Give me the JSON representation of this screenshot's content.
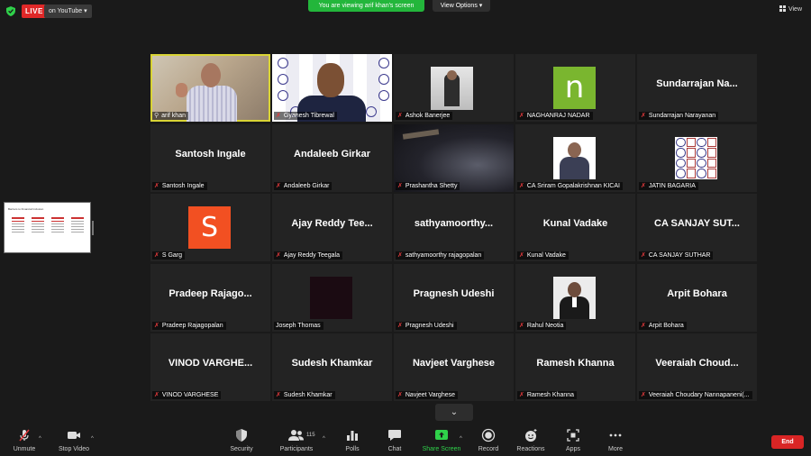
{
  "topbar": {
    "live_label": "LIVE",
    "stream_target": "on YouTube",
    "viewing_banner": "You are viewing arif khan's screen",
    "view_options": "View Options",
    "view_button": "View"
  },
  "shared_screen": {
    "title": "Barriers to Financial Inclusion"
  },
  "participants": [
    {
      "label": "arif khan",
      "tile_name": "",
      "kind": "video-arif",
      "muted": false,
      "pinned": true,
      "active": true
    },
    {
      "label": "Gyanesh Tibrewal",
      "tile_name": "",
      "kind": "video-gyan",
      "muted": true
    },
    {
      "label": "Ashok Banerjee",
      "tile_name": "",
      "kind": "photo-ashok",
      "muted": true
    },
    {
      "label": "NAGHANRAJ NADAR",
      "tile_name": "",
      "kind": "avatar-n",
      "avatar_letter": "n",
      "muted": true
    },
    {
      "label": "Sundarrajan Narayanan",
      "tile_name": "Sundarrajan Na...",
      "kind": "name",
      "muted": true
    },
    {
      "label": "Santosh Ingale",
      "tile_name": "Santosh Ingale",
      "kind": "name",
      "muted": true
    },
    {
      "label": "Andaleeb Girkar",
      "tile_name": "Andaleeb Girkar",
      "kind": "name",
      "muted": true
    },
    {
      "label": "Prashantha Shetty",
      "tile_name": "",
      "kind": "video-prash",
      "muted": true
    },
    {
      "label": "CA Sriram Gopalakrishnan KICAI",
      "tile_name": "",
      "kind": "photo-sriram",
      "muted": true
    },
    {
      "label": "JATIN BAGARIA",
      "tile_name": "",
      "kind": "logo-grid",
      "muted": true
    },
    {
      "label": "S Garg",
      "tile_name": "",
      "kind": "avatar-s",
      "avatar_letter": "S",
      "muted": true
    },
    {
      "label": "Ajay Reddy Teegala",
      "tile_name": "Ajay Reddy Tee...",
      "kind": "name",
      "muted": true
    },
    {
      "label": "sathyamoorthy rajagopalan",
      "tile_name": "sathyamoorthy...",
      "kind": "name",
      "muted": true
    },
    {
      "label": "Kunal Vadake",
      "tile_name": "Kunal Vadake",
      "kind": "name",
      "muted": true
    },
    {
      "label": "CA SANJAY SUTHAR",
      "tile_name": "CA SANJAY SUT...",
      "kind": "name",
      "muted": true
    },
    {
      "label": "Pradeep Rajagopalan",
      "tile_name": "Pradeep Rajago...",
      "kind": "name",
      "muted": true
    },
    {
      "label": "Joseph Thomas",
      "tile_name": "",
      "kind": "dark-box",
      "muted": false
    },
    {
      "label": "Pragnesh Udeshi",
      "tile_name": "Pragnesh Udeshi",
      "kind": "name",
      "muted": true
    },
    {
      "label": "Rahul Neotia",
      "tile_name": "",
      "kind": "photo-rahul",
      "muted": true
    },
    {
      "label": "Arpit Bohara",
      "tile_name": "Arpit Bohara",
      "kind": "name",
      "muted": true
    },
    {
      "label": "VINOD VARGHESE",
      "tile_name": "VINOD VARGHE...",
      "kind": "name",
      "muted": true
    },
    {
      "label": "Sudesh Khamkar",
      "tile_name": "Sudesh Khamkar",
      "kind": "name",
      "muted": true
    },
    {
      "label": "Navjeet Varghese",
      "tile_name": "Navjeet Varghese",
      "kind": "name",
      "muted": true
    },
    {
      "label": "Ramesh Khanna",
      "tile_name": "Ramesh Khanna",
      "kind": "name",
      "muted": true
    },
    {
      "label": "Veeraiah Choudary Nannapaneni(...",
      "tile_name": "Veeraiah Choud...",
      "kind": "name",
      "muted": true
    }
  ],
  "toolbar": {
    "unmute": "Unmute",
    "stop_video": "Stop Video",
    "security": "Security",
    "participants": "Participants",
    "participants_count": "115",
    "polls": "Polls",
    "chat": "Chat",
    "share_screen": "Share Screen",
    "record": "Record",
    "reactions": "Reactions",
    "apps": "Apps",
    "more": "More",
    "end": "End"
  },
  "icons": {
    "share_screen_color": "#2fd14a",
    "live_color": "#e02828",
    "viewing_banner_color": "#23b63b",
    "active_speaker_color": "#d9d435",
    "end_color": "#d92525"
  }
}
